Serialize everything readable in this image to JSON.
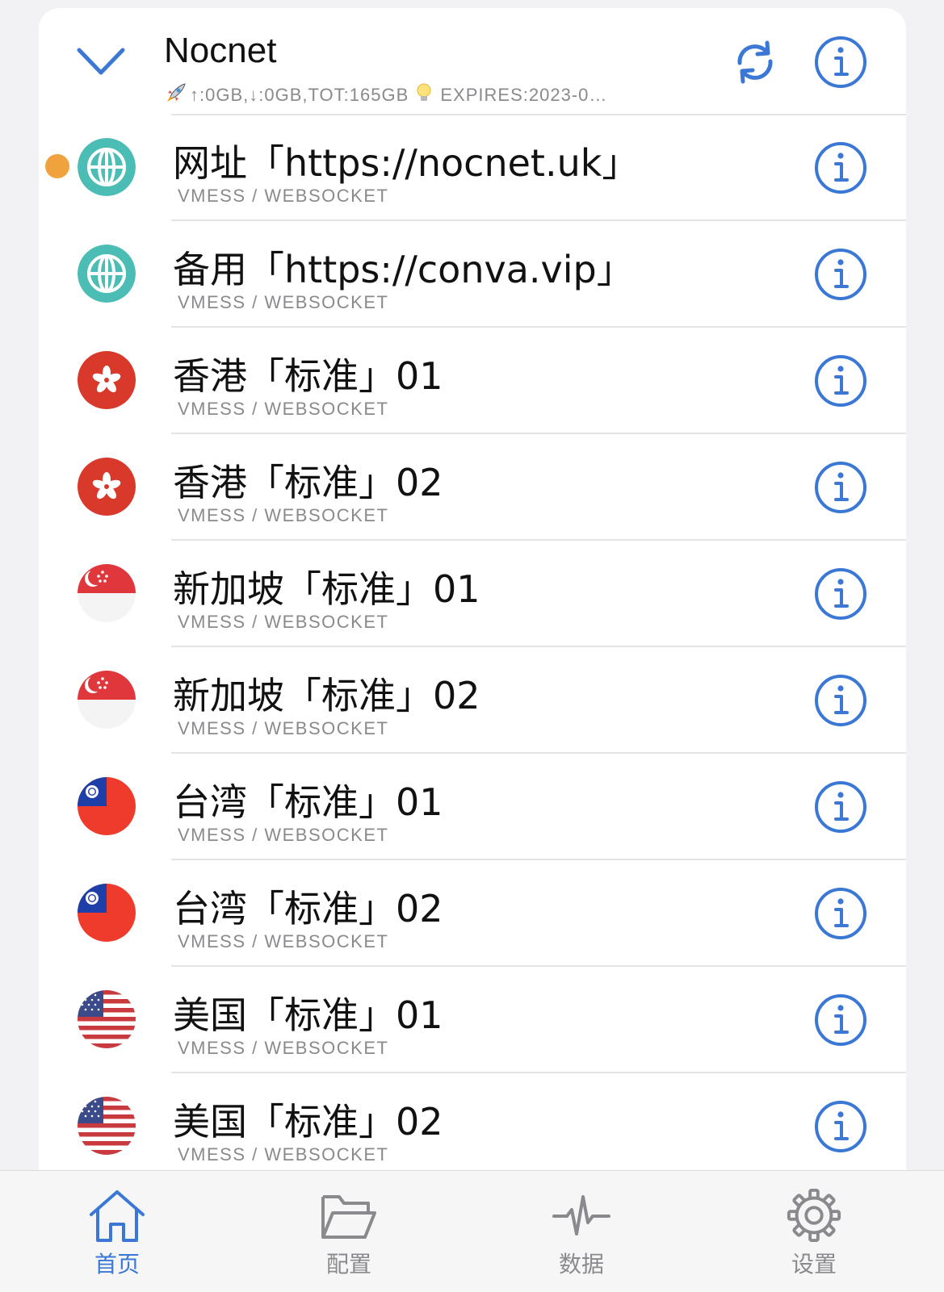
{
  "header": {
    "title": "Nocnet",
    "subtitle_traffic": "↑:0GB,↓:0GB,TOT:165GB",
    "subtitle_expiry": "EXPIRES:2023-0…"
  },
  "colors": {
    "accent": "#3b78d6",
    "selected_dot": "#f0a23c",
    "globe": "#4cbdb4",
    "hk_red": "#d8392b",
    "text_secondary": "#8a8a8e"
  },
  "nodes": [
    {
      "name": "网址「https://nocnet.uk」",
      "protocol": "VMESS / WEBSOCKET",
      "flag": "globe",
      "selected": true
    },
    {
      "name": "备用「https://conva.vip」",
      "protocol": "VMESS / WEBSOCKET",
      "flag": "globe",
      "selected": false
    },
    {
      "name": "香港「标准」01",
      "protocol": "VMESS / WEBSOCKET",
      "flag": "hong-kong",
      "selected": false
    },
    {
      "name": "香港「标准」02",
      "protocol": "VMESS / WEBSOCKET",
      "flag": "hong-kong",
      "selected": false
    },
    {
      "name": "新加坡「标准」01",
      "protocol": "VMESS / WEBSOCKET",
      "flag": "singapore",
      "selected": false
    },
    {
      "name": "新加坡「标准」02",
      "protocol": "VMESS / WEBSOCKET",
      "flag": "singapore",
      "selected": false
    },
    {
      "name": "台湾「标准」01",
      "protocol": "VMESS / WEBSOCKET",
      "flag": "taiwan",
      "selected": false
    },
    {
      "name": "台湾「标准」02",
      "protocol": "VMESS / WEBSOCKET",
      "flag": "taiwan",
      "selected": false
    },
    {
      "name": "美国「标准」01",
      "protocol": "VMESS / WEBSOCKET",
      "flag": "usa",
      "selected": false
    },
    {
      "name": "美国「标准」02",
      "protocol": "VMESS / WEBSOCKET",
      "flag": "usa",
      "selected": false
    }
  ],
  "tabs": [
    {
      "label": "首页",
      "icon": "home-icon",
      "active": true
    },
    {
      "label": "配置",
      "icon": "folder-icon",
      "active": false
    },
    {
      "label": "数据",
      "icon": "pulse-icon",
      "active": false
    },
    {
      "label": "设置",
      "icon": "gear-icon",
      "active": false
    }
  ]
}
